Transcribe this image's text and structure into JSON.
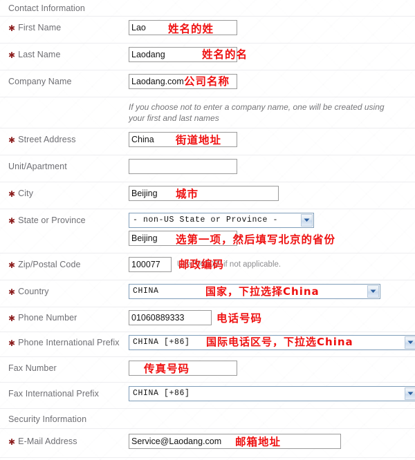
{
  "sections": {
    "contact": "Contact Information",
    "security": "Security Information"
  },
  "labels": {
    "first_name": "First Name",
    "last_name": "Last Name",
    "company_name": "Company Name",
    "street_address": "Street Address",
    "unit_apartment": "Unit/Apartment",
    "city": "City",
    "state_province": "State or Province",
    "zip_postal": "Zip/Postal Code",
    "country": "Country",
    "phone_number": "Phone Number",
    "phone_prefix": "Phone International Prefix",
    "fax_number": "Fax Number",
    "fax_prefix": "Fax International Prefix",
    "email": "E-Mail Address"
  },
  "required_marker": "✱",
  "values": {
    "first_name": "Lao",
    "last_name": "Laodang",
    "company_name": "Laodang.com",
    "street_address": "China",
    "unit_apartment": "",
    "city": "Beijing",
    "state_select": "- non-US State or Province -",
    "state_text": "Beijing",
    "zip_postal": "100077",
    "country_select": "CHINA",
    "phone_number": "01060889333",
    "phone_prefix_select": "CHINA [+86]",
    "fax_number": "",
    "fax_prefix_select": "CHINA [+86]",
    "email": "Service@Laodang.com"
  },
  "hints": {
    "company_note": "If you choose not to enter a company name, one will be created using your first and last names",
    "zip_note": "Use \"00000\" if not applicable."
  },
  "annotations": {
    "first_name": "姓名的姓",
    "last_name": "姓名的名",
    "company_name": "公司名称",
    "street_address": "街道地址",
    "city": "城市",
    "state_province": "选第一项，然后填写北京的省份",
    "zip_postal": "邮政编码",
    "country": "国家，下拉选择China",
    "phone_number": "电话号码",
    "phone_prefix": "国际电话区号，下拉选China",
    "fax_number": "传真号码",
    "email": "邮箱地址"
  },
  "colors": {
    "annotation_red": "#ee1111",
    "required_star": "#8c1f1f",
    "label_gray": "#6e6e73",
    "row_divider": "#ededf0",
    "input_border": "#9a9a9a",
    "select_border": "#7f9db9"
  }
}
